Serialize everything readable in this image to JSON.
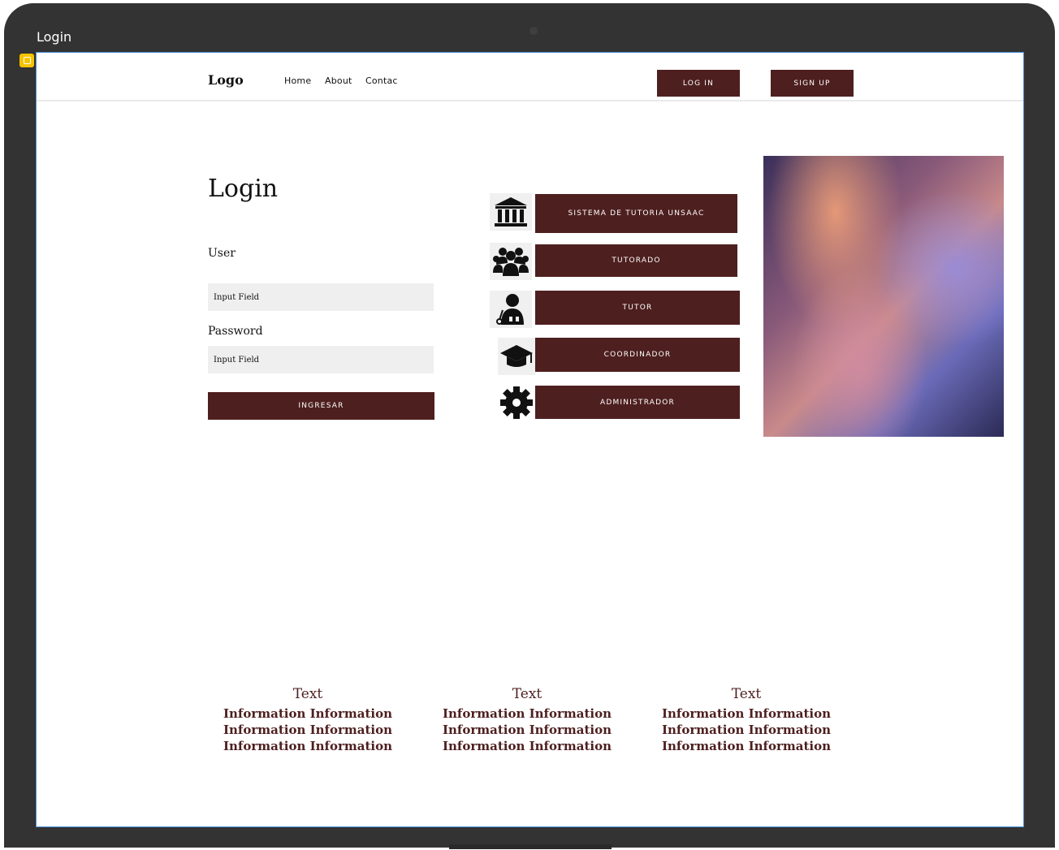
{
  "window": {
    "title": "Login"
  },
  "nav": {
    "logo": "Logo",
    "links": [
      "Home",
      "About",
      "Contac"
    ],
    "login_label": "LOG IN",
    "signup_label": "SIGN UP"
  },
  "login": {
    "title": "Login",
    "user_label": "User",
    "user_value": "Input Field",
    "password_label": "Password",
    "password_value": "Input Field",
    "submit_label": "INGRESAR"
  },
  "roles": [
    {
      "label": "SISTEMA DE TUTORIA UNSAAC",
      "icon": "institution-icon"
    },
    {
      "label": "TUTORADO",
      "icon": "group-icon"
    },
    {
      "label": "TUTOR",
      "icon": "user-tie-icon"
    },
    {
      "label": "COORDINADOR",
      "icon": "graduation-cap-icon"
    },
    {
      "label": "ADMINISTRADOR",
      "icon": "gear-icon"
    }
  ],
  "footer": [
    {
      "title": "Text",
      "lines": [
        "Information Information",
        "Information Information",
        "Information Information"
      ]
    },
    {
      "title": "Text",
      "lines": [
        "Information Information",
        "Information Information",
        "Information Information"
      ]
    },
    {
      "title": "Text",
      "lines": [
        "Information Information",
        "Information Information",
        "Information Information"
      ]
    }
  ],
  "colors": {
    "accent": "#4e1f1f",
    "frame": "#333333",
    "input_bg": "#efefef",
    "selection": "#4a90d9",
    "badge": "#f5c400"
  }
}
